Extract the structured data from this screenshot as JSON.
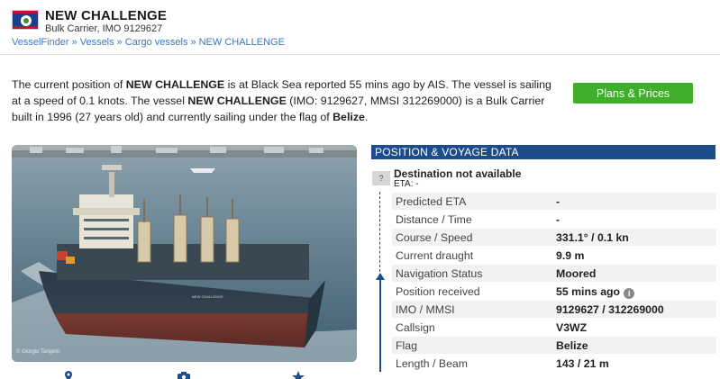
{
  "vessel": {
    "name": "NEW CHALLENGE",
    "subtitle": "Bulk Carrier, IMO 9129627",
    "flag_icon": "belize-flag-icon"
  },
  "breadcrumb": {
    "items": [
      "VesselFinder",
      "Vessels",
      "Cargo vessels",
      "NEW CHALLENGE"
    ],
    "separator": "»"
  },
  "description": {
    "p1": "The current position of ",
    "name1": "NEW CHALLENGE",
    "p2": " is at Black Sea reported 55 mins ago by AIS. The vessel is sailing at a speed of 0.1 knots. The vessel ",
    "name2": "NEW CHALLENGE",
    "p3": " (IMO: 9129627, MMSI 312269000) is a Bulk Carrier built in 1996 (27 years old) and currently sailing under the flag of ",
    "flag_country": "Belize",
    "p4": "."
  },
  "plans_button": "Plans & Prices",
  "photo": {
    "copyright": "© Giorgio Tangelo"
  },
  "voyage": {
    "header": "POSITION & VOYAGE DATA",
    "destination_icon": "?",
    "destination": "Destination not available",
    "eta": "ETA: -",
    "rows": [
      {
        "label": "Predicted ETA",
        "value": "-"
      },
      {
        "label": "Distance / Time",
        "value": "-"
      },
      {
        "label": "Course / Speed",
        "value": "331.1° / 0.1 kn"
      },
      {
        "label": "Current draught",
        "value": "9.9 m"
      },
      {
        "label": "Navigation Status",
        "value": "Moored"
      },
      {
        "label": "Position received",
        "value": "55 mins ago"
      },
      {
        "label": "IMO / MMSI",
        "value": "9129627 / 312269000"
      },
      {
        "label": "Callsign",
        "value": "V3WZ"
      },
      {
        "label": "Flag",
        "value": "Belize"
      },
      {
        "label": "Length / Beam",
        "value": "143 / 21 m"
      }
    ]
  },
  "colors": {
    "header_blue": "#1d4c8c",
    "button_green": "#3fae2a",
    "link_blue": "#3a78c2"
  }
}
